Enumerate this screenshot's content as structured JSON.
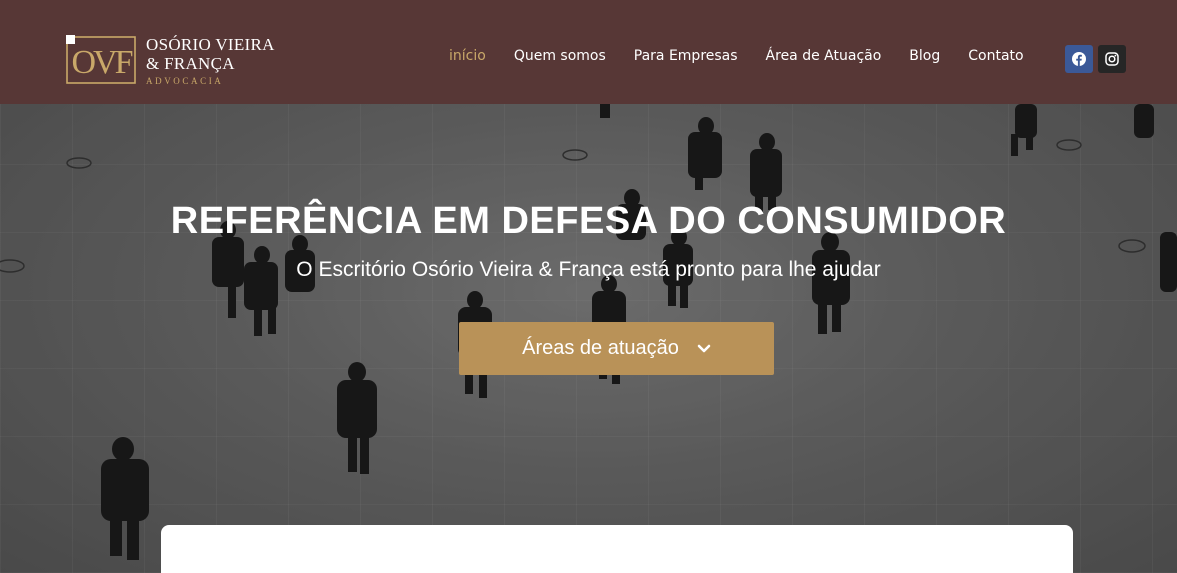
{
  "header": {
    "logo": {
      "monogram": "OVF",
      "line1": "OSÓRIO VIEIRA",
      "line2": "& FRANÇA",
      "line3": "ADVOCACIA"
    },
    "nav": [
      {
        "label": "início",
        "active": true
      },
      {
        "label": "Quem somos",
        "active": false
      },
      {
        "label": "Para Empresas",
        "active": false
      },
      {
        "label": "Área de Atuação",
        "active": false
      },
      {
        "label": "Blog",
        "active": false
      },
      {
        "label": "Contato",
        "active": false
      }
    ],
    "social": [
      {
        "icon": "facebook-icon",
        "color": "#3b5998"
      },
      {
        "icon": "instagram-icon",
        "color": "#262626"
      }
    ]
  },
  "hero": {
    "title": "REFERÊNCIA EM DEFESA DO CONSUMIDOR",
    "subtitle": "O Escritório Osório Vieira & França está pronto para lhe ajudar",
    "cta_label": "Áreas de atuação",
    "cta_icon": "chevron-down-icon"
  },
  "colors": {
    "header_bg": "#573736",
    "accent_gold": "#b99258",
    "nav_active": "#c9a869"
  }
}
